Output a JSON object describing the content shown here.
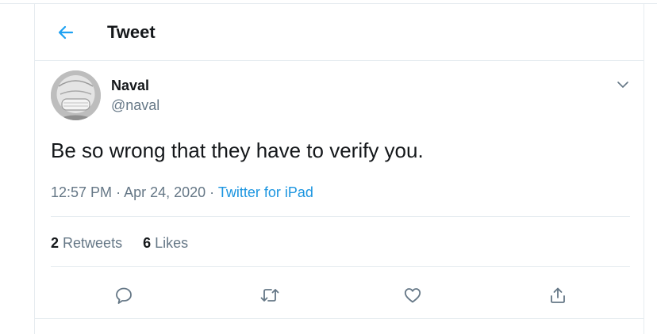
{
  "header": {
    "title": "Tweet",
    "back_icon": "back-arrow-icon"
  },
  "tweet": {
    "author_name": "Naval",
    "author_handle": "@naval",
    "text": "Be so wrong that they have to verify you.",
    "time": "12:57 PM",
    "separator": "·",
    "date": "Apr 24, 2020",
    "source": "Twitter for iPad",
    "retweets_count": "2",
    "retweets_label": "Retweets",
    "likes_count": "6",
    "likes_label": "Likes"
  },
  "actions": [
    "reply-icon",
    "retweet-icon",
    "like-icon",
    "share-icon"
  ],
  "colors": {
    "accent": "#1da1f2",
    "link": "#1b95e0",
    "muted": "#657786",
    "text": "#14171a",
    "divider": "#e6ecf0"
  }
}
